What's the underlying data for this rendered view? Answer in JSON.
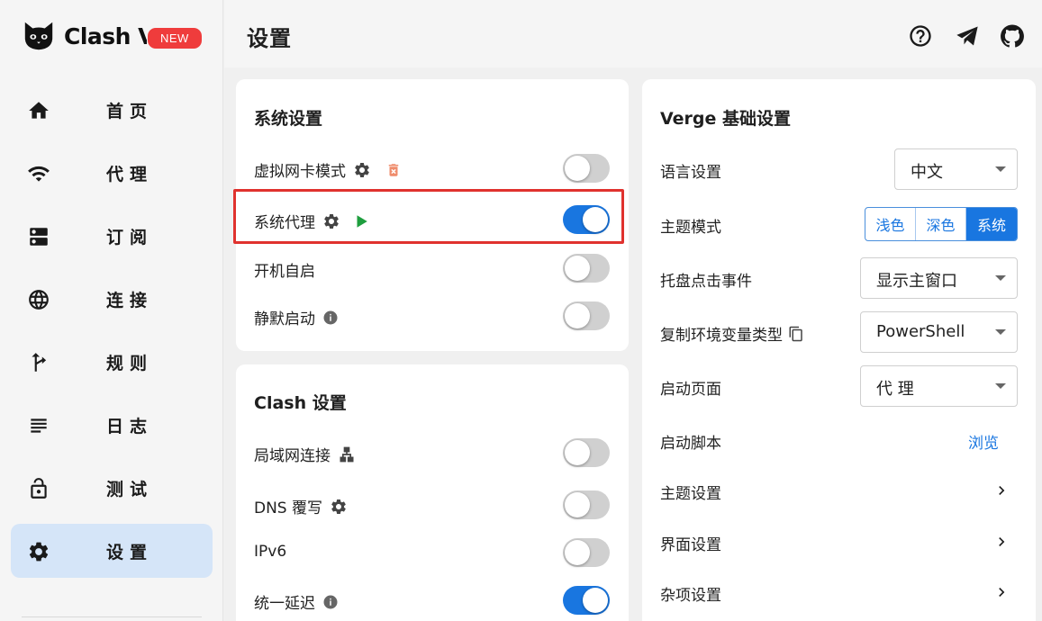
{
  "app": {
    "name": "Clash Verge",
    "badge": "NEW"
  },
  "sidebar": {
    "items": [
      {
        "label": "首页",
        "icon": "home-icon"
      },
      {
        "label": "代理",
        "icon": "wifi-icon"
      },
      {
        "label": "订阅",
        "icon": "dns-icon"
      },
      {
        "label": "连接",
        "icon": "language-globe-icon"
      },
      {
        "label": "规则",
        "icon": "fork-arrow-icon"
      },
      {
        "label": "日志",
        "icon": "subject-lines-icon"
      },
      {
        "label": "测试",
        "icon": "lock-open-icon"
      },
      {
        "label": "设置",
        "icon": "gear-icon",
        "active": true
      }
    ]
  },
  "header": {
    "title": "设置",
    "icons": [
      "help-circle-icon",
      "telegram-icon",
      "github-icon"
    ]
  },
  "system_settings": {
    "title": "系统设置",
    "rows": [
      {
        "label": "虚拟网卡模式",
        "toggle": false
      },
      {
        "label": "系统代理",
        "toggle": true
      },
      {
        "label": "开机自启",
        "toggle": false
      },
      {
        "label": "静默启动",
        "toggle": false
      }
    ]
  },
  "clash_settings": {
    "title": "Clash 设置",
    "rows": [
      {
        "label": "局域网连接",
        "toggle": false
      },
      {
        "label": "DNS 覆写",
        "toggle": false
      },
      {
        "label": "IPv6",
        "toggle": false
      },
      {
        "label": "统一延迟",
        "toggle": true
      }
    ]
  },
  "verge_settings": {
    "title": "Verge 基础设置",
    "language": {
      "label": "语言设置",
      "value": "中文"
    },
    "theme_mode": {
      "label": "主题模式",
      "options": [
        "浅色",
        "深色",
        "系统"
      ],
      "selected": "系统"
    },
    "tray_click": {
      "label": "托盘点击事件",
      "value": "显示主窗口"
    },
    "copy_env": {
      "label": "复制环境变量类型",
      "value": "PowerShell"
    },
    "start_page": {
      "label": "启动页面",
      "value": "代 理"
    },
    "start_script": {
      "label": "启动脚本",
      "link": "浏览"
    },
    "theme_settings": {
      "label": "主题设置"
    },
    "layout_settings": {
      "label": "界面设置"
    },
    "misc_settings": {
      "label": "杂项设置"
    }
  },
  "colors": {
    "accent": "#1976e0",
    "active_nav_bg": "#d5e5f8",
    "highlight_border": "#e0322e",
    "new_badge": "#ef3c3c",
    "play_green": "#1e9e3e",
    "delete_orange": "#ef8c6c"
  }
}
